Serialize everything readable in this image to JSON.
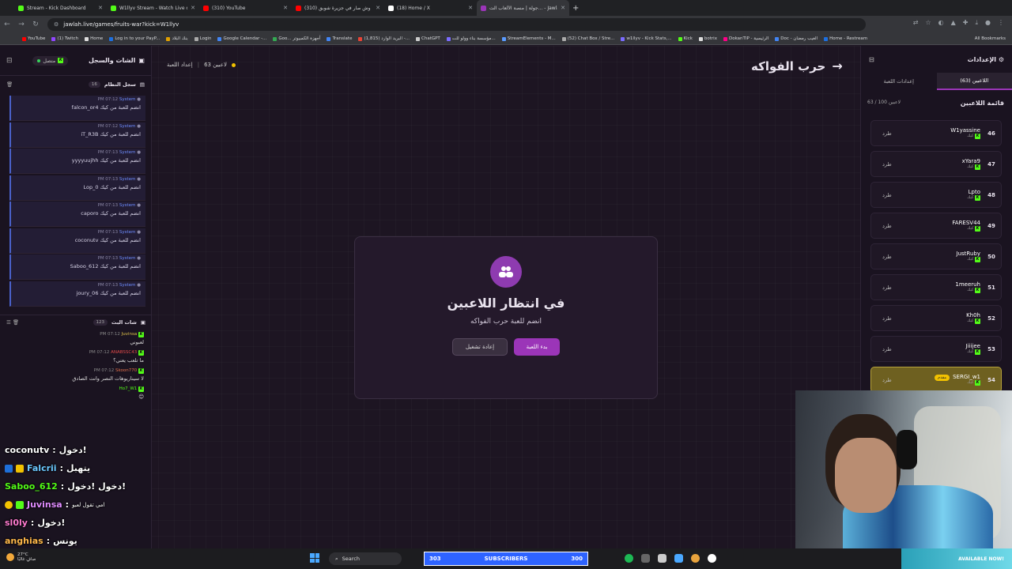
{
  "browser": {
    "tabs": [
      {
        "title": "Stream - Kick Dashboard",
        "color": "#53fc18"
      },
      {
        "title": "W1llyv Stream - Watch Live on Kick",
        "color": "#53fc18"
      },
      {
        "title": "(310) YouTube",
        "color": "#ff0000"
      },
      {
        "title": "(310) وش صار في جزيرة شوبق",
        "color": "#ff0000"
      },
      {
        "title": "(18) Home / X",
        "color": "#ffffff"
      },
      {
        "title": "جولة | منصة الألعاب الت... - Jawlah",
        "color": "#9b35b8",
        "active": true
      }
    ],
    "new_tab": "+",
    "url": "jawlah.live/games/fruits-war?kick=W1llyv",
    "bookmarks": [
      "YouTube",
      "(1) Twitch",
      "Home",
      "Log in to your PayP...",
      "بنك البلاد",
      "Login",
      "Google Calendar -...",
      "Goo... أجهزة الكمبيوتر",
      "Translate",
      "(1,815) البريد الوارد -...",
      "ChatGPT",
      "مؤسسة بناء وولو للت...",
      "StreamElements - M...",
      "(52) Chat Box / Stre...",
      "w1llyv - Kick Stats,...",
      "Kick",
      "botrix",
      "DokanTIP - الرئيسية",
      "Doc - الغيب رمضان",
      "Home - Restream"
    ],
    "all_bookmarks": "All Bookmarks"
  },
  "left_panel": {
    "title": "الشات والسجل",
    "status": "متصل",
    "system_log": {
      "label": "سجل النظام",
      "count": "16"
    },
    "system_messages": [
      {
        "time": "PM 07:12",
        "author": "System",
        "text": "falcon_or4 انضم للعبة من كيك"
      },
      {
        "time": "PM 07:12",
        "author": "System",
        "text": "iT_R3B انضم للعبة من كيك"
      },
      {
        "time": "PM 07:13",
        "author": "System",
        "text": "yyyyuujhh انضم للعبة من كيك"
      },
      {
        "time": "PM 07:13",
        "author": "System",
        "text": "Lop_0 انضم للعبة من كيك"
      },
      {
        "time": "PM 07:13",
        "author": "System",
        "text": "caporo انضم للعبة من كيك"
      },
      {
        "time": "PM 07:13",
        "author": "System",
        "text": "coconutv انضم للعبة من كيك"
      },
      {
        "time": "PM 07:13",
        "author": "System",
        "text": "Saboo_612 انضم للعبة من كيك"
      },
      {
        "time": "PM 07:13",
        "author": "System",
        "text": "joury_06 انضم للعبة من كيك"
      }
    ],
    "stream_chat": {
      "label": "شات البث",
      "count": "123"
    },
    "chat_messages": [
      {
        "time": "PM 07:12",
        "author": "Juvinsa",
        "text": "لعبوني"
      },
      {
        "time": "PM 07:12",
        "author": "ANABSSC43",
        "text": "ما تلعب يعني؟"
      },
      {
        "time": "PM 07:12",
        "author": "Skoon770",
        "text": "لا سيناريوهات النصر وانت الصادق"
      },
      {
        "time": "PM 07:12",
        "author": "Ho7_W1",
        "text": "😊"
      }
    ]
  },
  "stream_overlay_chat": [
    {
      "user": "coconutv",
      "text": "دخول!"
    },
    {
      "user": "Falcrii",
      "text": "يتهبل"
    },
    {
      "user": "Saboo_612",
      "text": "دخول !دخول!"
    },
    {
      "user": "Juvinsa",
      "text": "امي تقول لعبو"
    },
    {
      "user": "sl0ly",
      "text": "دخول!"
    },
    {
      "user": "anghias",
      "text": "يونس"
    }
  ],
  "center": {
    "game_title": "حرب الفواكه",
    "players_count": "63 لاعبين",
    "game_settings": "إعداد اللعبة",
    "card": {
      "heading": "في انتظار اللاعبين",
      "subtitle": "انضم للعبة حرب الفواكه",
      "start_button": "بدء اللعبة",
      "restart_button": "إعادة تشغيل"
    }
  },
  "right_panel": {
    "title": "الإعدادات",
    "tabs": [
      "اللاعبين (63)",
      "إعدادات اللعبة"
    ],
    "list_title": "قائمة اللاعبين",
    "list_count": "63 / 100 لاعبين",
    "kick_label": "طرد",
    "platform": "كيك",
    "host_badge": "مقدم",
    "players": [
      {
        "num": "46",
        "name": "W1yassine"
      },
      {
        "num": "47",
        "name": "xYara9"
      },
      {
        "num": "48",
        "name": "Lpto"
      },
      {
        "num": "49",
        "name": "FARESV44"
      },
      {
        "num": "50",
        "name": "JustRuby"
      },
      {
        "num": "51",
        "name": "1meeruh"
      },
      {
        "num": "52",
        "name": "Kh0h"
      },
      {
        "num": "53",
        "name": "Jiiijee"
      },
      {
        "num": "54",
        "name": "SERGI_w1",
        "host": true
      }
    ]
  },
  "taskbar": {
    "weather_temp": "27°C",
    "weather_desc": "صافٍ غالبًا",
    "search": "Search",
    "subs_left": "303",
    "subs_label": "SUBSCRIBERS",
    "subs_right": "300",
    "promo": "AVAILABLE NOW!"
  }
}
